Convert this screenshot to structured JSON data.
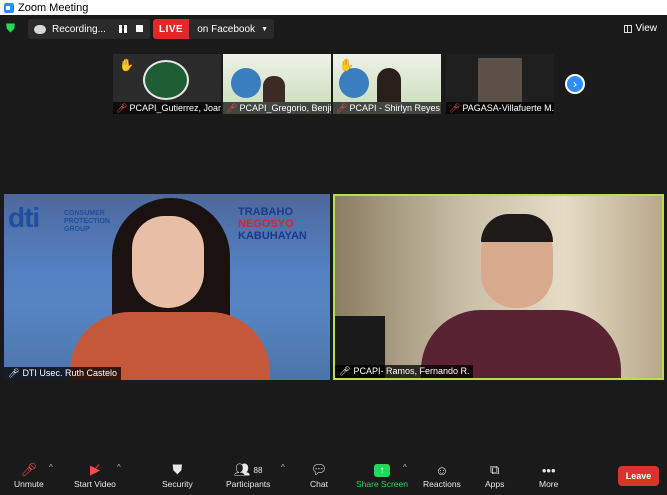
{
  "window": {
    "title": "Zoom Meeting"
  },
  "topbar": {
    "recording_label": "Recording...",
    "live_label": "LIVE",
    "live_target": "on Facebook",
    "view_label": "View"
  },
  "participants_strip": [
    {
      "name": "PCAPI_Gutierrez, Joan..."
    },
    {
      "name": "PCAPI_Gregorio, Benjie"
    },
    {
      "name": "PCAPI - Shirlyn Reyes"
    },
    {
      "name": "PAGASA-Villafuerte M..."
    }
  ],
  "tiles": {
    "left_name": "DTI Usec. Ruth Castelo",
    "left_logo_text": "dti",
    "left_group_text": "CONSUMER PROTECTION GROUP",
    "left_slogan": [
      "TRABAHO",
      "NEGOSYO",
      "KABUHAYAN"
    ],
    "right_name": "PCAPI- Ramos, Fernando R."
  },
  "toolbar": {
    "unmute": "Unmute",
    "start_video": "Start Video",
    "security": "Security",
    "participants": "Participants",
    "participants_count": "88",
    "chat": "Chat",
    "share_screen": "Share Screen",
    "reactions": "Reactions",
    "apps": "Apps",
    "more": "More",
    "leave": "Leave"
  },
  "colors": {
    "live": "#e02828",
    "active_speaker": "#b6e052",
    "share": "#23d959",
    "leave": "#d9342b"
  }
}
